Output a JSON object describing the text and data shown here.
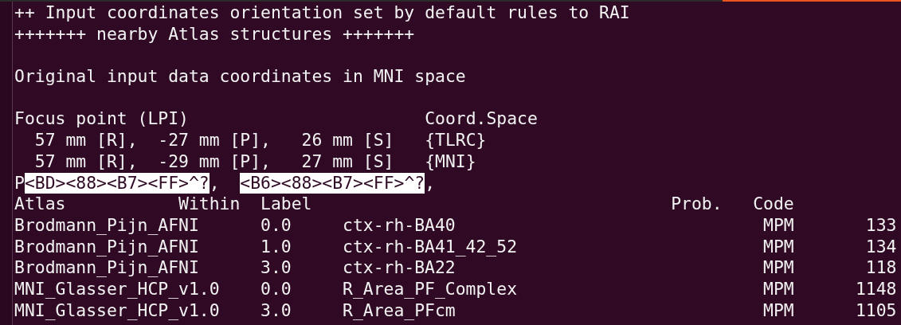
{
  "terminal": {
    "lines": [
      {
        "kind": "text",
        "text": "++ Input coordinates orientation set by default rules to RAI"
      },
      {
        "kind": "text",
        "text": "+++++++ nearby Atlas structures +++++++"
      },
      {
        "kind": "blank"
      },
      {
        "kind": "text",
        "text": "Original input data coordinates in MNI space"
      },
      {
        "kind": "blank"
      },
      {
        "kind": "text",
        "text": "Focus point (LPI)                       Coord.Space"
      },
      {
        "kind": "text",
        "text": "  57 mm [R],  -27 mm [P],   26 mm [S]   {TLRC}"
      },
      {
        "kind": "text",
        "text": "  57 mm [R],  -29 mm [P],   27 mm [S]   {MNI}"
      },
      {
        "kind": "segments",
        "segments": [
          {
            "text": "P",
            "highlighted": false
          },
          {
            "text": "<BD><88><B7><FF>^?",
            "highlighted": true
          },
          {
            "text": ",  ",
            "highlighted": false
          },
          {
            "text": "<B6><88><B7><FF>^?",
            "highlighted": true
          },
          {
            "text": ",",
            "highlighted": false
          }
        ]
      }
    ],
    "table": {
      "header": "Atlas           Within  Label                                   Prob.   Code",
      "rows": [
        [
          "Brodmann_Pijn_AFNI",
          "0.0",
          "ctx-rh-BA40",
          "MPM",
          "133"
        ],
        [
          "Brodmann_Pijn_AFNI",
          "1.0",
          "ctx-rh-BA41_42_52",
          "MPM",
          "134"
        ],
        [
          "Brodmann_Pijn_AFNI",
          "3.0",
          "ctx-rh-BA22",
          "MPM",
          "118"
        ],
        [
          "MNI_Glasser_HCP_v1.0",
          "0.0",
          "R_Area_PF_Complex",
          "MPM",
          "1148"
        ],
        [
          "MNI_Glasser_HCP_v1.0",
          "3.0",
          "R_Area_PFcm",
          "MPM",
          "1105"
        ]
      ]
    }
  }
}
